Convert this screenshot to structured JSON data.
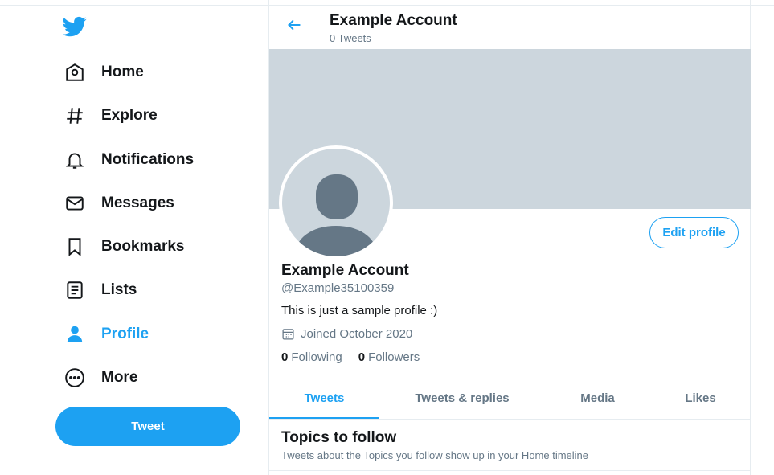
{
  "nav": {
    "items": [
      {
        "label": "Home",
        "icon": "home-icon"
      },
      {
        "label": "Explore",
        "icon": "hashtag-icon"
      },
      {
        "label": "Notifications",
        "icon": "bell-icon"
      },
      {
        "label": "Messages",
        "icon": "envelope-icon"
      },
      {
        "label": "Bookmarks",
        "icon": "bookmark-icon"
      },
      {
        "label": "Lists",
        "icon": "list-icon"
      },
      {
        "label": "Profile",
        "icon": "person-icon",
        "active": true
      },
      {
        "label": "More",
        "icon": "more-icon"
      }
    ],
    "tweet_button": "Tweet"
  },
  "header": {
    "title": "Example Account",
    "subtitle": "0 Tweets"
  },
  "profile": {
    "display_name": "Example Account",
    "handle": "@Example35100359",
    "bio": "This is just a sample profile :)",
    "joined": "Joined October 2020",
    "following_count": "0",
    "following_label": "Following",
    "followers_count": "0",
    "followers_label": "Followers",
    "edit_button": "Edit profile"
  },
  "tabs": [
    {
      "label": "Tweets",
      "active": true
    },
    {
      "label": "Tweets & replies"
    },
    {
      "label": "Media"
    },
    {
      "label": "Likes"
    }
  ],
  "topics": {
    "title": "Topics to follow",
    "subtitle": "Tweets about the Topics you follow show up in your Home timeline"
  },
  "colors": {
    "accent": "#1da1f2",
    "banner": "#ccd6dd",
    "text": "#14171a",
    "muted": "#657786"
  }
}
